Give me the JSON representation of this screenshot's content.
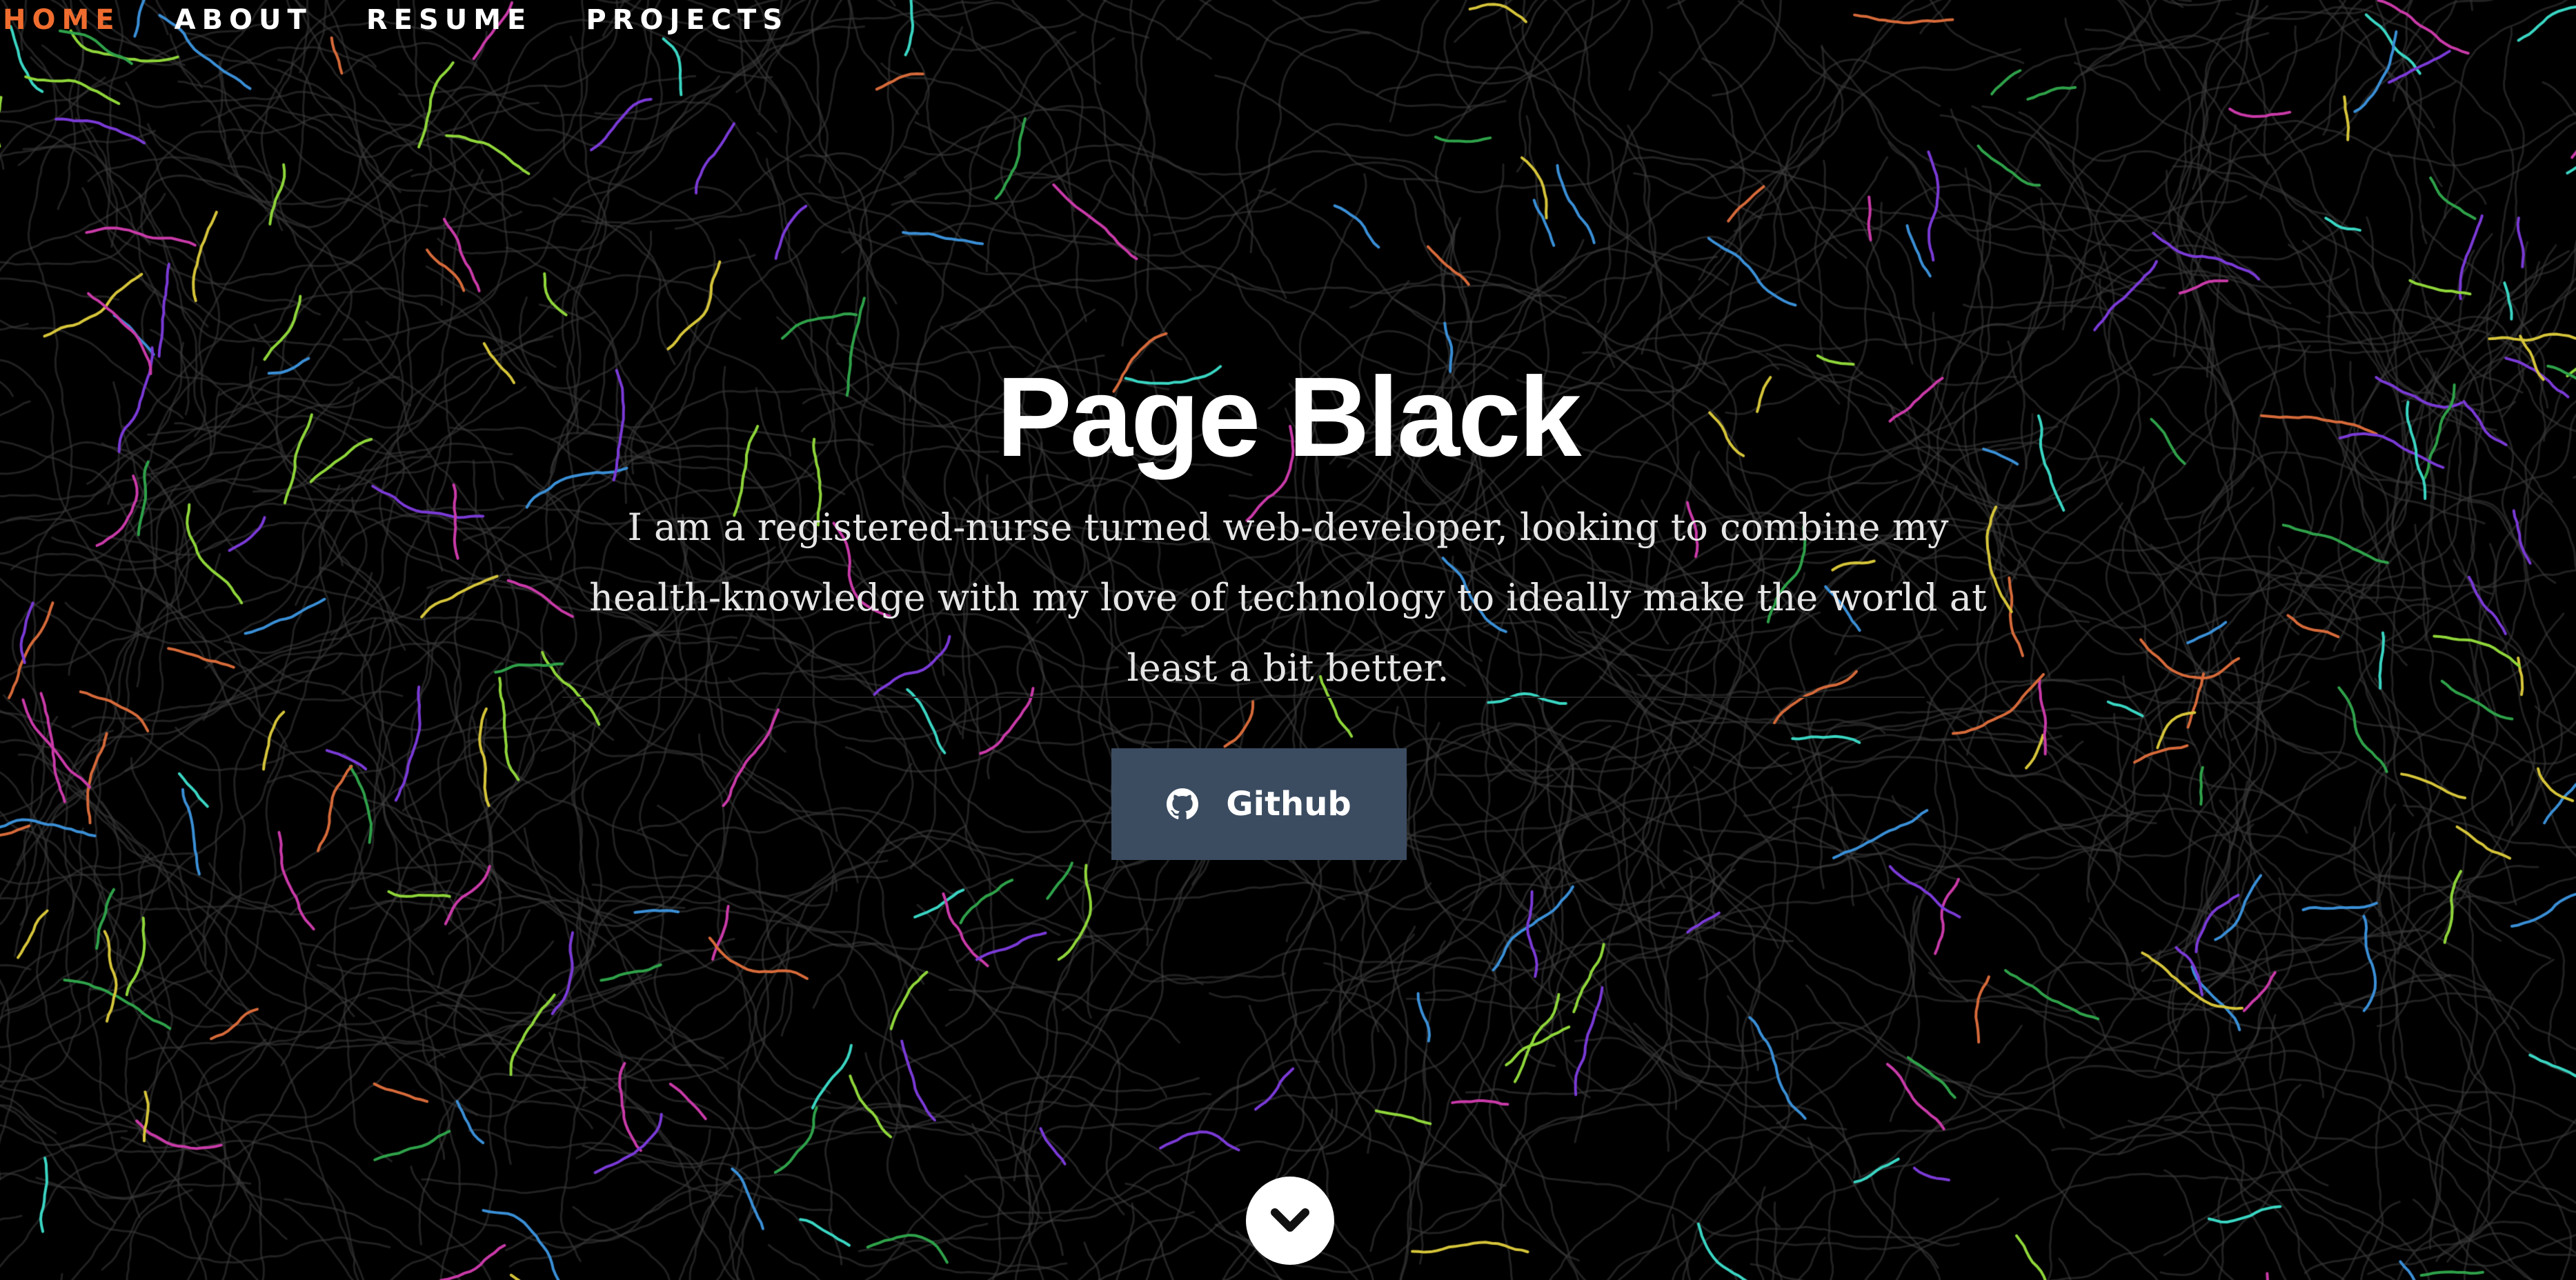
{
  "nav": {
    "items": [
      {
        "label": "HOME",
        "active": true
      },
      {
        "label": "ABOUT",
        "active": false
      },
      {
        "label": "RESUME",
        "active": false
      },
      {
        "label": "PROJECTS",
        "active": false
      }
    ],
    "active_color": "#f06d2f"
  },
  "hero": {
    "title": "Page Black",
    "tagline": "I am a registered-nurse turned web-developer, looking to combine my health-knowledge with my love of technology to ideally make the world at least a bit better.",
    "github_button": {
      "label": "Github",
      "icon": "github-icon"
    },
    "scroll_icon": "chevron-down-icon"
  },
  "colors": {
    "background": "#000000",
    "button_bg": "#3b4c61",
    "text": "#ffffff"
  }
}
